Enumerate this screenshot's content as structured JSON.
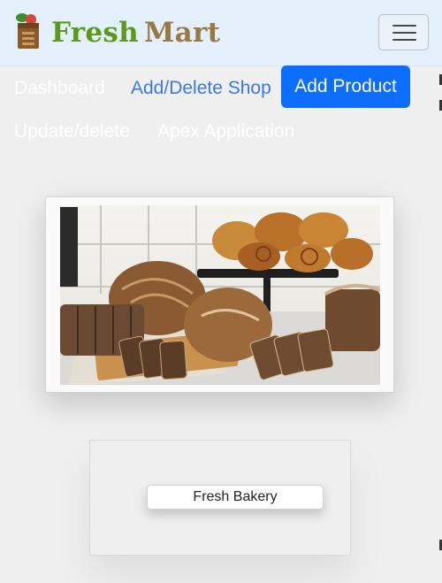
{
  "brand": {
    "word1": "Fresh",
    "word2": "Mart"
  },
  "nav": {
    "dashboard": "Dashboard",
    "add_delete_shop": "Add/Delete Shop",
    "add_product": "Add Product",
    "update_delete": "Update/delete",
    "apex_application": "Apex Application"
  },
  "card": {
    "image": "bakery-bread-photo",
    "label": "Fresh Bakery"
  },
  "colors": {
    "header_bg": "#e3effb",
    "page_bg": "#efefef",
    "brand_fresh": "#5a9a1a",
    "brand_mart": "#9a7842",
    "primary": "#0d6efd",
    "link_blue": "#3b78e7"
  },
  "icons": {
    "logo": "shop-bag-icon",
    "menu": "hamburger-menu-icon"
  }
}
